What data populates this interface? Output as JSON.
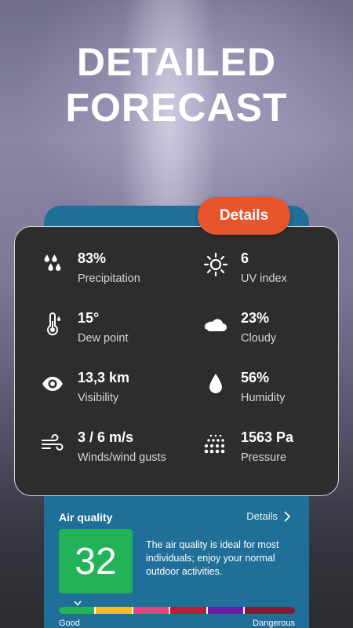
{
  "headline": {
    "line1": "DETAILED",
    "line2": "FORECAST"
  },
  "details_button": {
    "label": "Details"
  },
  "metrics": [
    {
      "icon": "raindrops-icon",
      "value": "83%",
      "label": "Precipitation"
    },
    {
      "icon": "sun-icon",
      "value": "6",
      "label": "UV index"
    },
    {
      "icon": "thermometer-icon",
      "value": "15°",
      "label": "Dew point"
    },
    {
      "icon": "cloud-icon",
      "value": "23%",
      "label": "Cloudy"
    },
    {
      "icon": "eye-icon",
      "value": "13,3 km",
      "label": "Visibility"
    },
    {
      "icon": "droplet-icon",
      "value": "56%",
      "label": "Humidity"
    },
    {
      "icon": "wind-icon",
      "value": "3 / 6 m/s",
      "label": "Winds/wind gusts"
    },
    {
      "icon": "pressure-icon",
      "value": "1563 Pa",
      "label": "Pressure"
    }
  ],
  "air_quality": {
    "title": "Air quality",
    "details_link": "Details",
    "index": "32",
    "description": "The air quality is ideal for most individuals; enjoy your normal outdoor activities.",
    "scale_low": "Good",
    "scale_high": "Dangerous",
    "scale_colors": [
      "#22b258",
      "#f2c117",
      "#e0457b",
      "#c2183a",
      "#6a1fa8",
      "#7a1f35"
    ],
    "level": 0.08
  },
  "colors": {
    "accent": "#e8542c",
    "card": "#2d2d2d",
    "panel_blue": "#1f6f99",
    "good_green": "#22b258"
  }
}
